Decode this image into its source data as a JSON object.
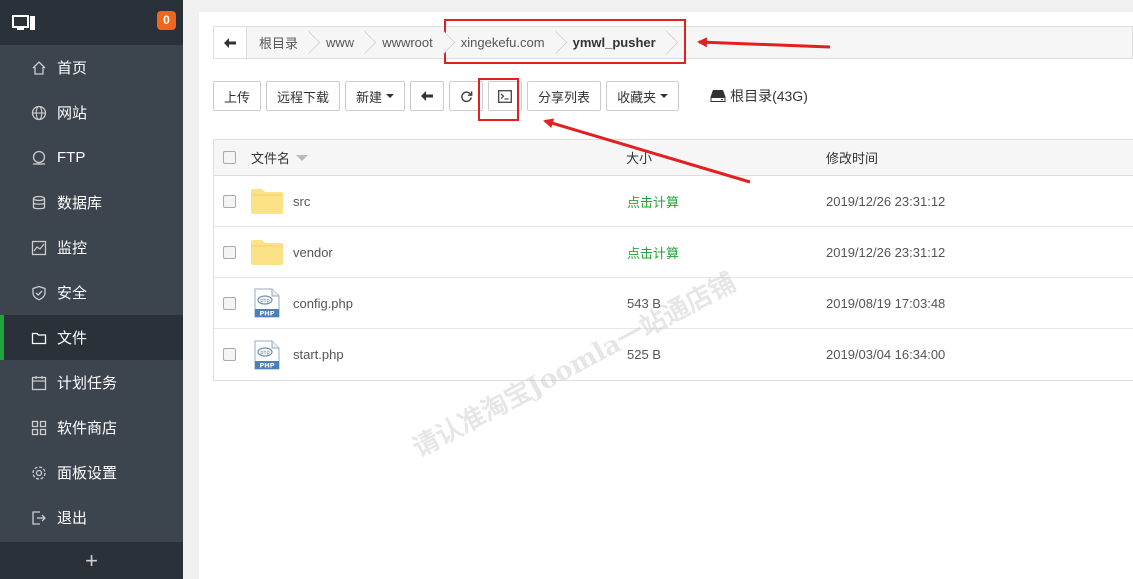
{
  "sidebar": {
    "badge": "0",
    "items": [
      {
        "label": "首页",
        "icon": "home-icon"
      },
      {
        "label": "网站",
        "icon": "globe-icon"
      },
      {
        "label": "FTP",
        "icon": "ftp-icon"
      },
      {
        "label": "数据库",
        "icon": "database-icon"
      },
      {
        "label": "监控",
        "icon": "monitor-chart-icon"
      },
      {
        "label": "安全",
        "icon": "shield-icon"
      },
      {
        "label": "文件",
        "icon": "folder-icon"
      },
      {
        "label": "计划任务",
        "icon": "calendar-icon"
      },
      {
        "label": "软件商店",
        "icon": "apps-grid-icon"
      },
      {
        "label": "面板设置",
        "icon": "gear-icon"
      },
      {
        "label": "退出",
        "icon": "logout-icon"
      }
    ],
    "active": "文件",
    "add_label": "+"
  },
  "breadcrumb": [
    "根目录",
    "www",
    "wwwroot",
    "xingekefu.com",
    "ymwl_pusher"
  ],
  "toolbar": {
    "upload": "上传",
    "remote_download": "远程下载",
    "new": "新建",
    "share_list": "分享列表",
    "favorites": "收藏夹",
    "disk": "根目录(43G)"
  },
  "table": {
    "headers": {
      "name": "文件名",
      "size": "大小",
      "time": "修改时间"
    },
    "rows": [
      {
        "name": "src",
        "type": "folder",
        "size": "点击计算",
        "time": "2019/12/26 23:31:12"
      },
      {
        "name": "vendor",
        "type": "folder",
        "size": "点击计算",
        "time": "2019/12/26 23:31:12"
      },
      {
        "name": "config.php",
        "type": "php",
        "size": "543 B",
        "time": "2019/08/19 17:03:48"
      },
      {
        "name": "start.php",
        "type": "php",
        "size": "525 B",
        "time": "2019/03/04 16:34:00"
      }
    ]
  },
  "watermark": "请认准淘宝Joomla一站通店铺",
  "colors": {
    "accent": "#20a53a",
    "badge": "#f0661d",
    "annotation": "#e32020"
  }
}
